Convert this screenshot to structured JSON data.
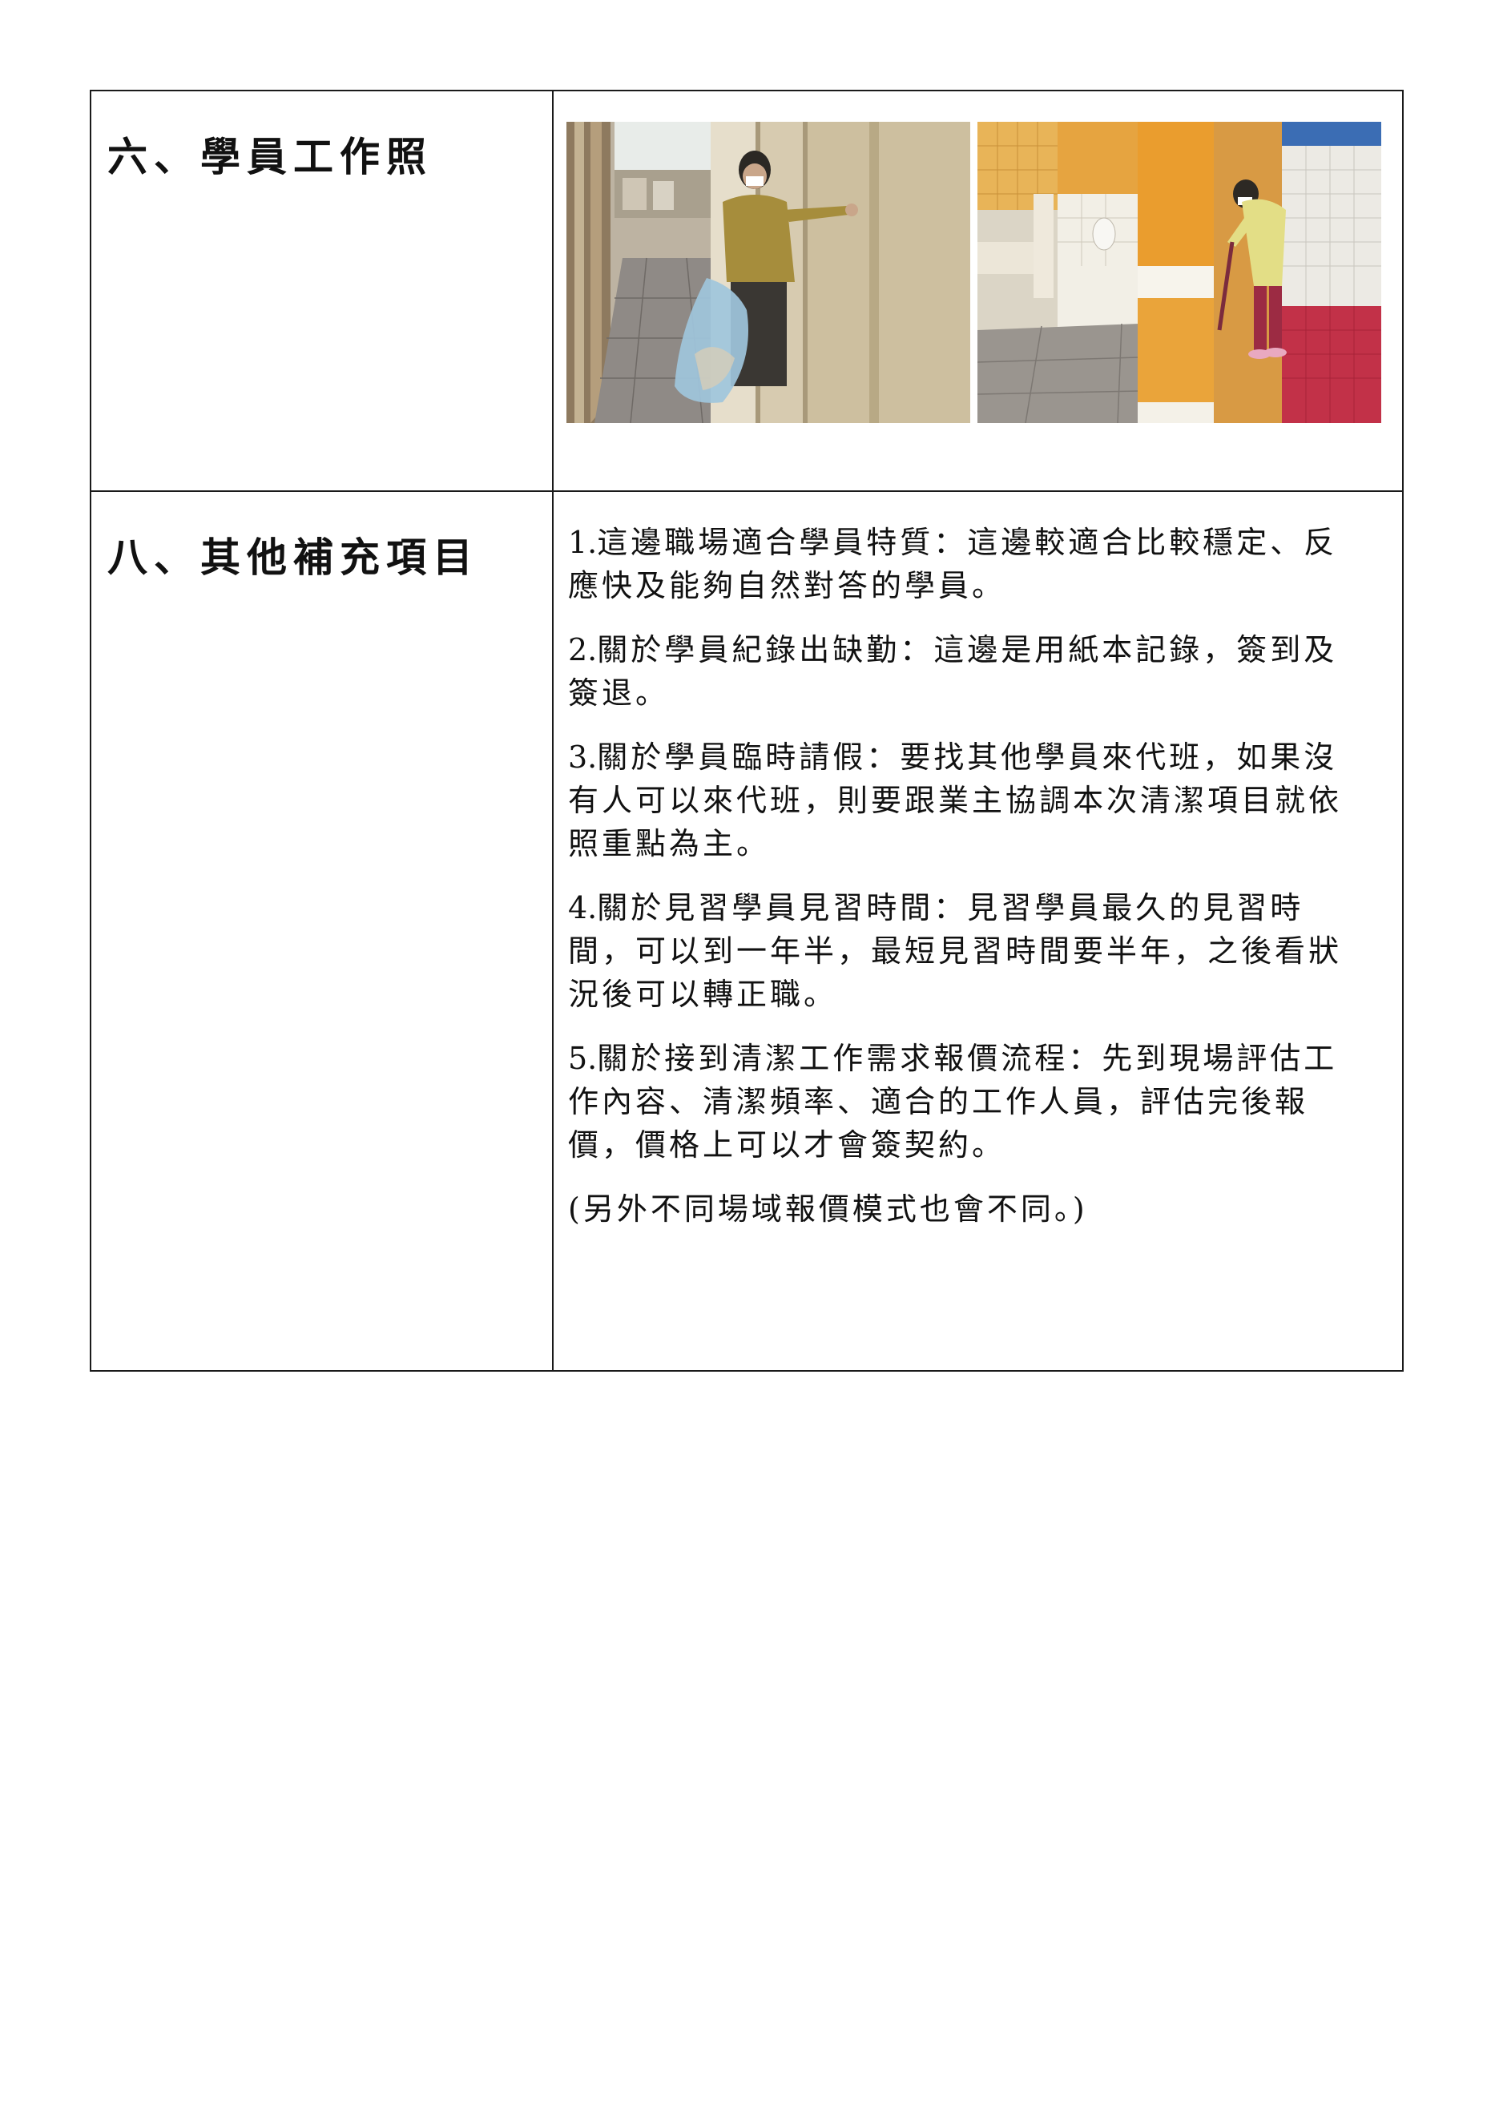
{
  "sections": [
    {
      "title": "六、學員工作照",
      "photos": [
        {
          "icon": "photo-worker-collecting-trash"
        },
        {
          "icon": "photo-worker-cleaning-restroom"
        }
      ]
    },
    {
      "title": "八、其他補充項目",
      "notes": [
        {
          "num": "1.",
          "text": "這邊職場適合學員特質：這邊較適合比較穩定、反應快及能夠自然對答的學員。"
        },
        {
          "num": "2.",
          "text": "關於學員紀錄出缺勤：這邊是用紙本記錄，簽到及簽退。"
        },
        {
          "num": "3.",
          "text": "關於學員臨時請假：要找其他學員來代班，如果沒有人可以來代班，則要跟業主協調本次清潔項目就依照重點為主。"
        },
        {
          "num": "4.",
          "text": "關於見習學員見習時間：見習學員最久的見習時間，可以到一年半，最短見習時間要半年，之後看狀況後可以轉正職。"
        },
        {
          "num": "5.",
          "text": "關於接到清潔工作需求報價流程：先到現場評估工作內容、清潔頻率、適合的工作人員，評估完後報價，價格上可以才會簽契約。"
        },
        {
          "num": "",
          "text": "(另外不同場域報價模式也會不同。)"
        }
      ]
    }
  ]
}
